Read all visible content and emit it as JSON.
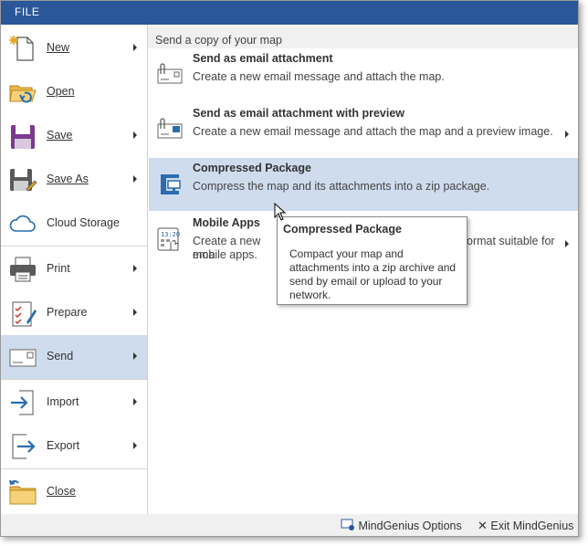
{
  "header": {
    "file_tab": "FILE"
  },
  "menu": {
    "items": [
      {
        "label": "New",
        "icon": "new-document-icon",
        "has_submenu": true
      },
      {
        "label": "Open",
        "icon": "open-folder-icon",
        "has_submenu": false
      },
      {
        "label": "Save",
        "icon": "save-disk-icon",
        "has_submenu": true
      },
      {
        "label": "Save As",
        "icon": "save-as-icon",
        "has_submenu": true
      },
      {
        "label": "Cloud Storage",
        "icon": "cloud-icon",
        "has_submenu": false
      },
      {
        "label": "Print",
        "icon": "printer-icon",
        "has_submenu": true
      },
      {
        "label": "Prepare",
        "icon": "checklist-icon",
        "has_submenu": true
      },
      {
        "label": "Send",
        "icon": "send-envelope-icon",
        "has_submenu": true,
        "active": true
      },
      {
        "label": "Import",
        "icon": "import-icon",
        "has_submenu": true
      },
      {
        "label": "Export",
        "icon": "export-icon",
        "has_submenu": true
      },
      {
        "label": "Close",
        "icon": "close-folder-icon",
        "has_submenu": false
      }
    ]
  },
  "send_panel": {
    "title": "Send a copy of your map",
    "options": [
      {
        "title": "Send as email attachment",
        "description": "Create a new email message and attach the map.",
        "icon": "email-attachment-icon",
        "has_submenu": false
      },
      {
        "title": "Send as email attachment with preview",
        "description": "Create a new email message and attach the map and a preview image.",
        "icon": "email-preview-icon",
        "has_submenu": true
      },
      {
        "title": "Compressed Package",
        "description": "Compress the map and its attachments into a zip package.",
        "icon": "compress-clamp-icon",
        "has_submenu": false,
        "highlighted": true
      },
      {
        "title": "Mobile Apps",
        "description_line1": "Create a new ema",
        "description_line1_end": "ormat suitable for",
        "description_line2": "mobile apps.",
        "icon": "mobile-apps-icon",
        "has_submenu": true
      }
    ]
  },
  "tooltip": {
    "title": "Compressed Package",
    "body": "Compact your map and attachments into a zip archive and send by email or upload to your network."
  },
  "statusbar": {
    "options_label": "MindGenius Options",
    "exit_label": "Exit MindGenius"
  },
  "colors": {
    "title_bar": "#2b579a",
    "selection": "#cfdcee",
    "panel_header": "#f0f0f0"
  }
}
